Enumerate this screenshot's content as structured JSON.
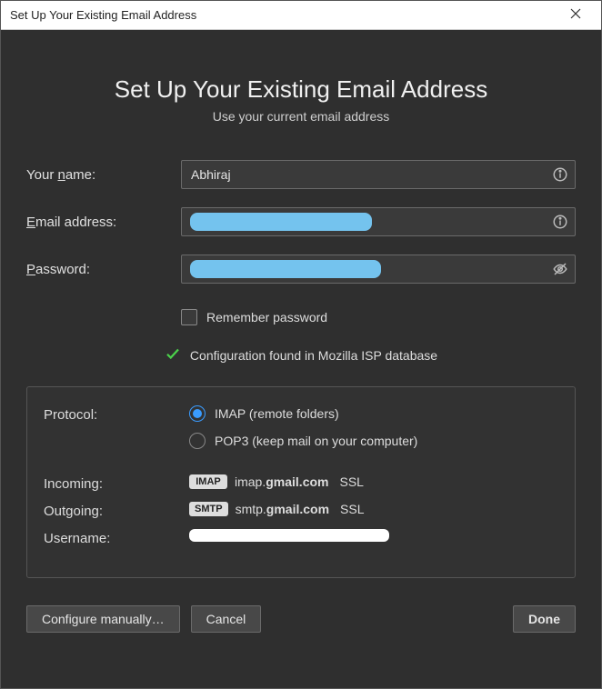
{
  "titlebar": {
    "title": "Set Up Your Existing Email Address"
  },
  "heading": "Set Up Your Existing Email Address",
  "subheading": "Use your current email address",
  "form": {
    "name": {
      "label_pre": "Your ",
      "label_u": "n",
      "label_post": "ame:",
      "value": "Abhiraj"
    },
    "email": {
      "label_u": "E",
      "label_post": "mail address:"
    },
    "password": {
      "label_u": "P",
      "label_post": "assword:"
    },
    "remember": {
      "label_pre": "Re",
      "label_u": "m",
      "label_post": "ember password"
    }
  },
  "status": {
    "text": "Configuration found in Mozilla ISP database"
  },
  "panel": {
    "protocol_label": "Protocol:",
    "imap_label": "IMAP (remote folders)",
    "pop3_label": "POP3 (keep mail on your computer)",
    "incoming_label": "Incoming:",
    "outgoing_label": "Outgoing:",
    "username_label": "Username:",
    "imap_badge": "IMAP",
    "smtp_badge": "SMTP",
    "incoming_pre": "imap.",
    "incoming_bold": "gmail.com",
    "outgoing_pre": "smtp.",
    "outgoing_bold": "gmail.com",
    "ssl": "SSL"
  },
  "buttons": {
    "configure_pre": "Configure ",
    "configure_u": "m",
    "configure_post": "anually…",
    "cancel": "Cancel",
    "done": "Done"
  }
}
